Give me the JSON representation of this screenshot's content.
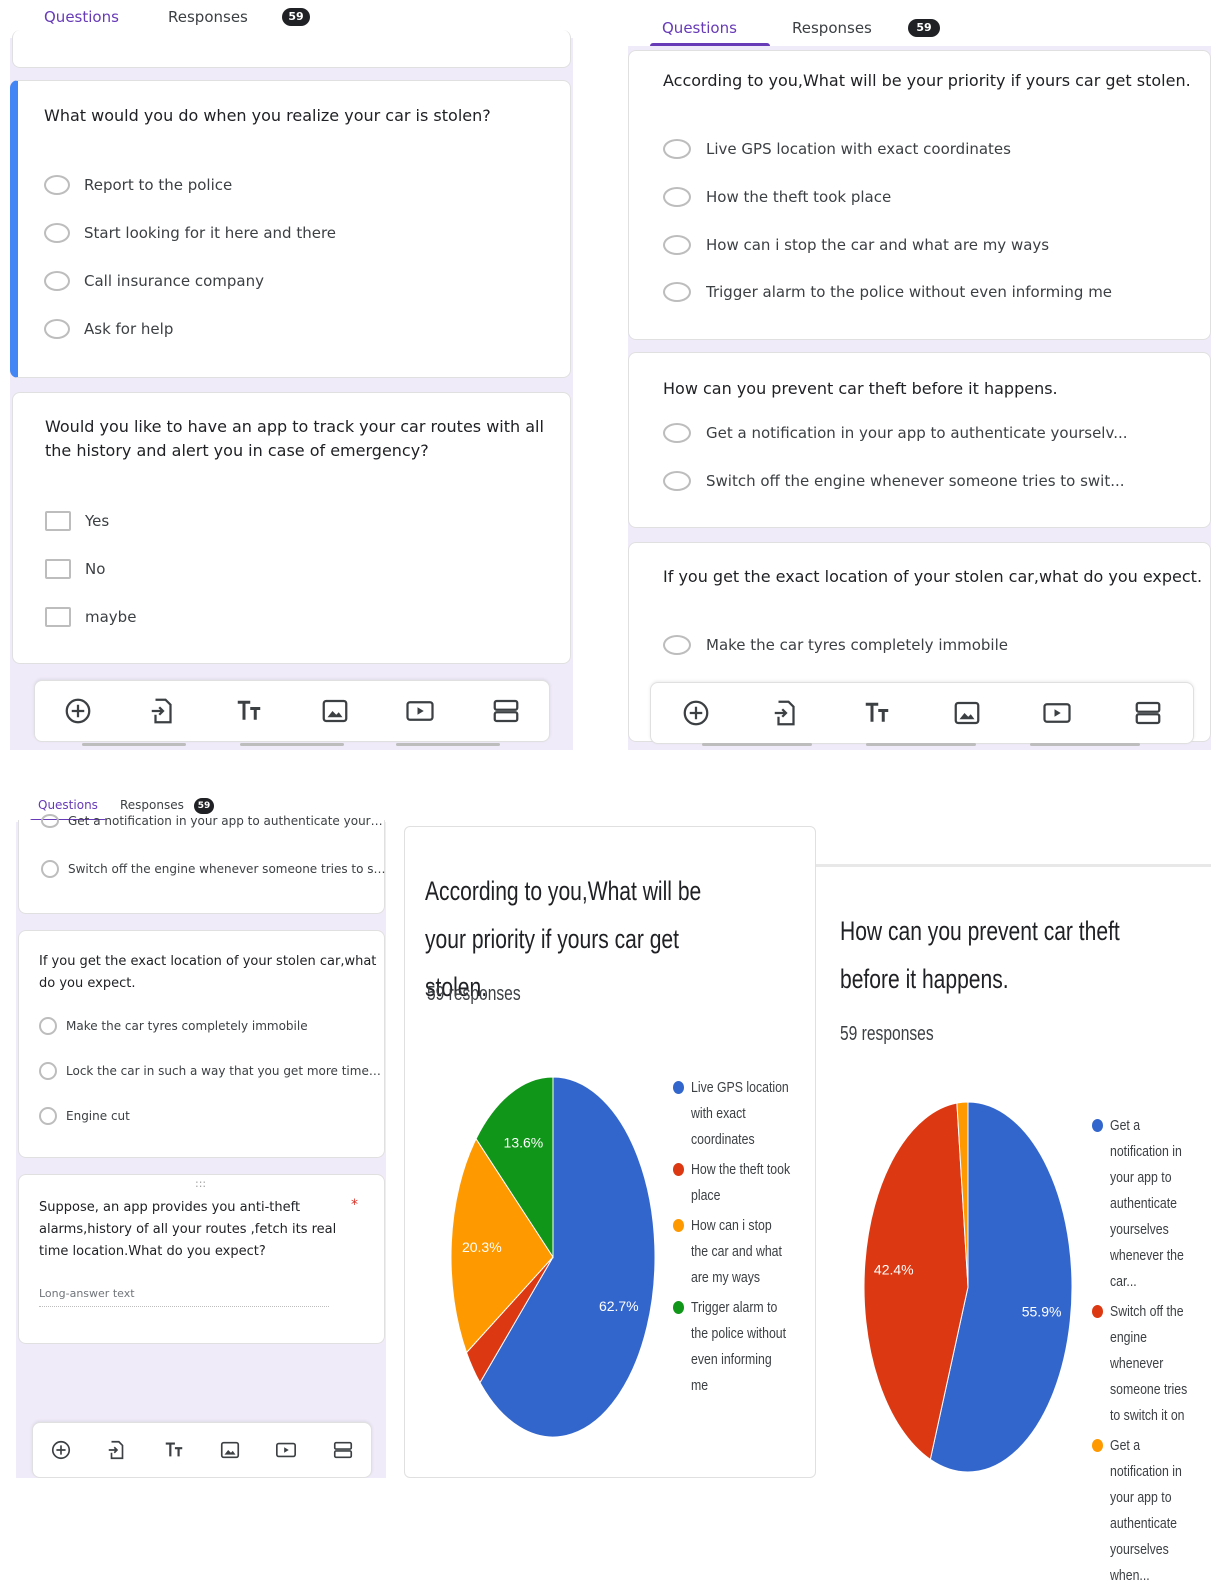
{
  "tabs": {
    "questions": "Questions",
    "responses": "Responses",
    "responses_count": "59"
  },
  "panel1": {
    "q1": {
      "text": "What would you do when you realize your car is stolen?",
      "options": [
        "Report to the police",
        "Start looking for it here and there",
        "Call insurance company",
        "Ask for help"
      ]
    },
    "q2": {
      "text": "Would you like to have an app to track your car routes with all the history and alert you in case of emergency?",
      "options": [
        "Yes",
        "No",
        "maybe"
      ]
    }
  },
  "panel2": {
    "q1": {
      "text": "According to you,What will be your priority if yours car get stolen.",
      "options": [
        "Live GPS location with exact coordinates",
        "How the theft took place",
        "How can i stop the car and what are my ways",
        "Trigger alarm to the police without even informing me"
      ]
    },
    "q2": {
      "text": "How can you prevent car theft before it happens.",
      "options": [
        "Get a notification in your app to authenticate yourselv...",
        "Switch off the engine whenever someone tries to swit..."
      ]
    },
    "q3": {
      "text": "If you get the exact location of your stolen car,what do you expect.",
      "options": [
        "Make the car tyres completely immobile"
      ]
    }
  },
  "panel3": {
    "partial_options": [
      "Get a notification in your app to authenticate yourselv...",
      "Switch off the engine whenever someone tries to swit..."
    ],
    "q1": {
      "text": "If you get the exact location of your stolen car,what do you expect.",
      "options": [
        "Make the car tyres completely immobile",
        "Lock the car in such a way that you get more time to r...",
        "Engine cut"
      ]
    },
    "q2": {
      "text": "Suppose, an app provides you anti-theft alarms,history of all your routes ,fetch its real time location.What do you expect?",
      "required": "*",
      "placeholder": "Long-answer text",
      "drag": ":::"
    }
  },
  "toolbar_icons": [
    "add-question-icon",
    "import-questions-icon",
    "add-title-icon",
    "add-image-icon",
    "add-video-icon",
    "add-section-icon"
  ],
  "colors": {
    "blue": "#3366cc",
    "red": "#dc3912",
    "orange": "#ff9900",
    "green": "#109618",
    "purple": "#673ab7"
  },
  "chart_data": [
    {
      "type": "pie",
      "title": "According to you,What will be your priority if yours car get stolen.",
      "subtitle": "59 responses",
      "categories": [
        "Live GPS location with exact coordinates",
        "How the theft took place",
        "How can i stop the car and what are my ways",
        "Trigger alarm to the police without even informing me"
      ],
      "values": [
        62.7,
        3.4,
        20.3,
        13.6
      ],
      "labels": [
        "62.7%",
        "",
        "20.3%",
        "13.6%"
      ],
      "colors": [
        "#3366cc",
        "#dc3912",
        "#ff9900",
        "#109618"
      ],
      "legend": "right"
    },
    {
      "type": "pie",
      "title": "How can you prevent car theft before it happens.",
      "subtitle": "59 responses",
      "categories": [
        "Get a notification in your app to authenticate yourselves whenever the car...",
        "Switch off the engine whenever someone tries to switch it on",
        "Get a notification in your app to authenticate yourselves when..."
      ],
      "values": [
        55.9,
        42.4,
        1.7
      ],
      "labels": [
        "55.9%",
        "42.4%",
        ""
      ],
      "colors": [
        "#3366cc",
        "#dc3912",
        "#ff9900"
      ],
      "legend": "right"
    }
  ]
}
